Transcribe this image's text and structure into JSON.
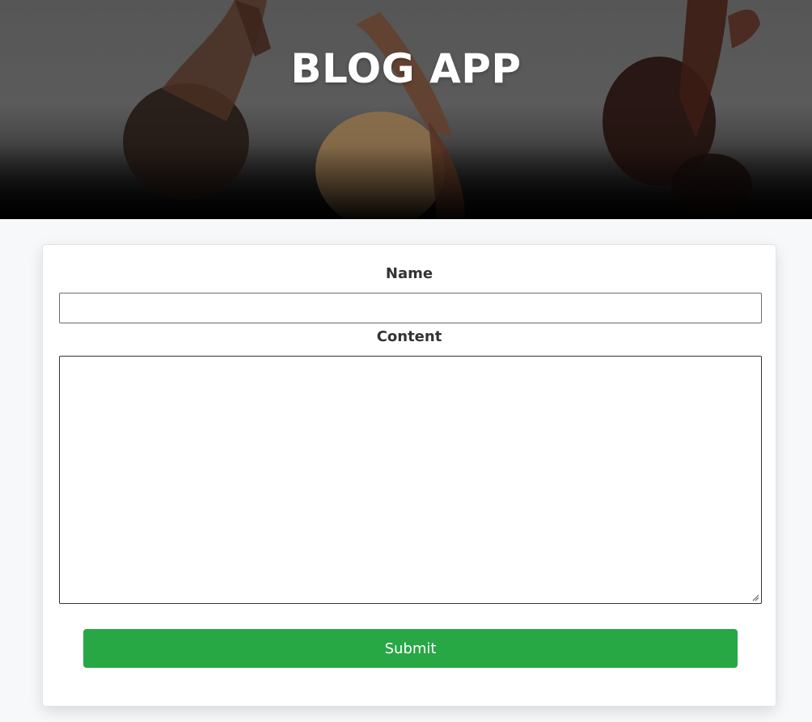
{
  "header": {
    "title": "BLOG APP",
    "overlay_color": "#000000",
    "hero_image_alt": "people raising hands"
  },
  "form": {
    "name_label": "Name",
    "name_value": "",
    "content_label": "Content",
    "content_value": "",
    "submit_label": "Submit",
    "submit_color": "#28a745"
  },
  "icons": {
    "resize": "resize-grip-icon"
  }
}
